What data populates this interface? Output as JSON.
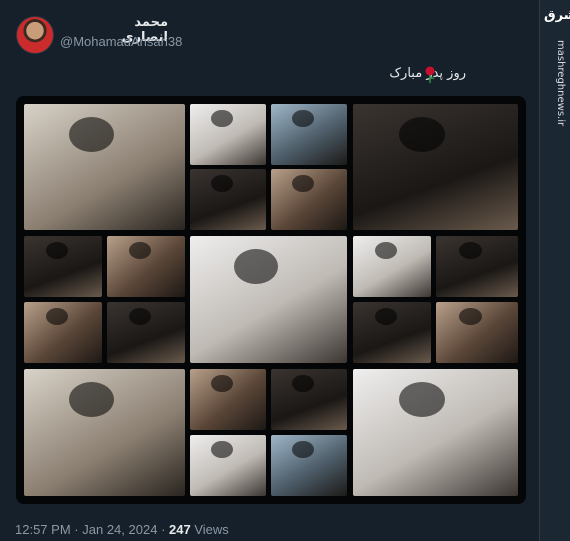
{
  "author": {
    "display_name": "محمد انصاری",
    "handle": "@MohamadAnsari38",
    "avatar_icon": "avatar-photo"
  },
  "post": {
    "text": "روز پدر مبارک",
    "emoji_icon": "rose-icon",
    "media_description_icon": "photo-collage"
  },
  "meta": {
    "time": "12:57 PM",
    "separator": "·",
    "date": "Jan 24, 2024",
    "views_count": "247",
    "views_label": "Views"
  },
  "watermark": {
    "logo_text": "مشرق",
    "url": "mashreghnews.ir"
  },
  "colors": {
    "background": "#15202b",
    "text_primary": "#e7e9ea",
    "text_secondary": "#8b98a5",
    "rose": "#c8102e"
  }
}
